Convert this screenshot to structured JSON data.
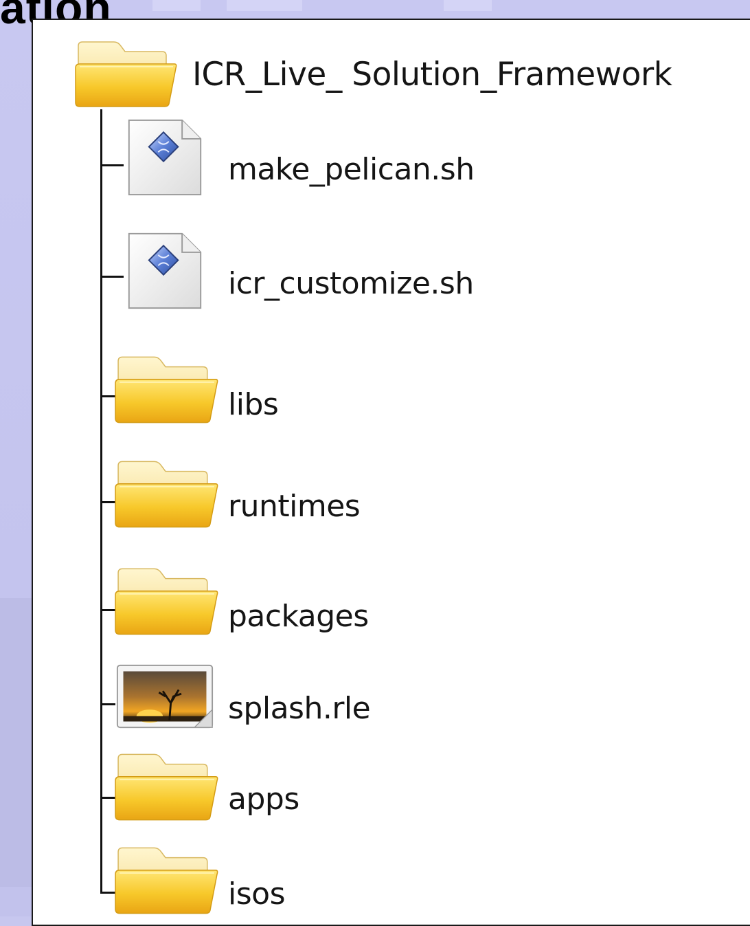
{
  "slide": {
    "title_fragment": "ation"
  },
  "tree": {
    "root": {
      "label": "ICR_Live_ Solution_Framework",
      "icon": "folder-icon"
    },
    "items": [
      {
        "label": "make_pelican.sh",
        "icon": "shell-script-icon"
      },
      {
        "label": "icr_customize.sh",
        "icon": "shell-script-icon"
      },
      {
        "label": "libs",
        "icon": "folder-icon"
      },
      {
        "label": "runtimes",
        "icon": "folder-icon"
      },
      {
        "label": "packages",
        "icon": "folder-icon"
      },
      {
        "label": "splash.rle",
        "icon": "image-file-icon"
      },
      {
        "label": "apps",
        "icon": "folder-icon"
      },
      {
        "label": "isos",
        "icon": "folder-icon"
      }
    ]
  },
  "colors": {
    "slide_background": "#c7c7ef",
    "folder_yellow": "#f5c21a",
    "tree_line": "#111111"
  }
}
